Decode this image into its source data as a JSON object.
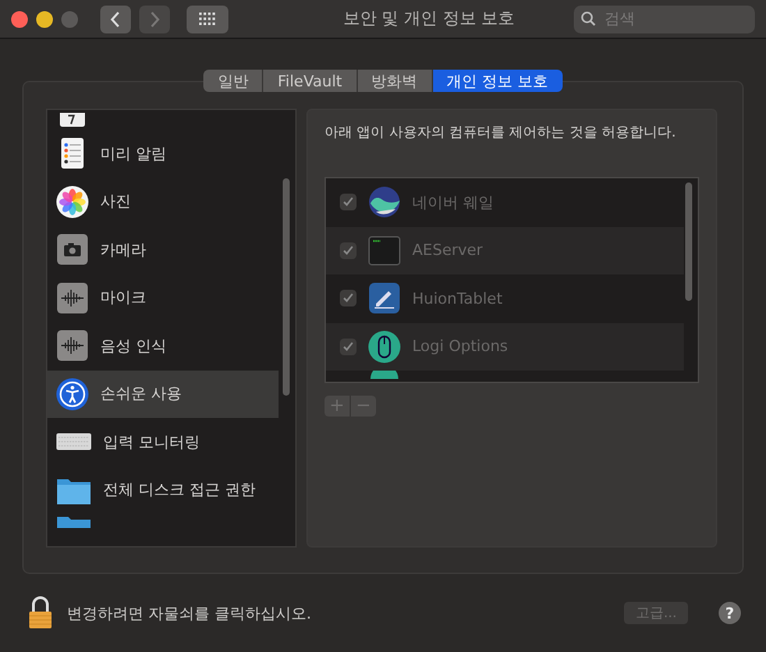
{
  "window": {
    "title": "보안 및 개인 정보 보호"
  },
  "search": {
    "placeholder": "검색"
  },
  "tabs": [
    {
      "label": "일반",
      "selected": false
    },
    {
      "label": "FileVault",
      "selected": false
    },
    {
      "label": "방화벽",
      "selected": false
    },
    {
      "label": "개인 정보 보호",
      "selected": true
    }
  ],
  "sidebar": {
    "items": [
      {
        "label": "미리 알림",
        "selected": false
      },
      {
        "label": "사진",
        "selected": false
      },
      {
        "label": "카메라",
        "selected": false
      },
      {
        "label": "마이크",
        "selected": false
      },
      {
        "label": "음성 인식",
        "selected": false
      },
      {
        "label": "손쉬운 사용",
        "selected": true
      },
      {
        "label": "입력 모니터링",
        "selected": false
      },
      {
        "label": "전체 디스크 접근 권한",
        "selected": false
      }
    ]
  },
  "panel": {
    "description": "아래 앱이 사용자의 컴퓨터를 제어하는 것을 허용합니다.",
    "apps": [
      {
        "name": "네이버 웨일",
        "checked": true
      },
      {
        "name": "AEServer",
        "checked": true
      },
      {
        "name": "HuionTablet",
        "checked": true
      },
      {
        "name": "Logi Options",
        "checked": true
      }
    ],
    "add_label": "+",
    "remove_label": "−",
    "disabled": true
  },
  "footer": {
    "locked": true,
    "message": "변경하려면 자물쇠를 클릭하십시오.",
    "advanced_button": "고급...",
    "help_button": "?"
  }
}
